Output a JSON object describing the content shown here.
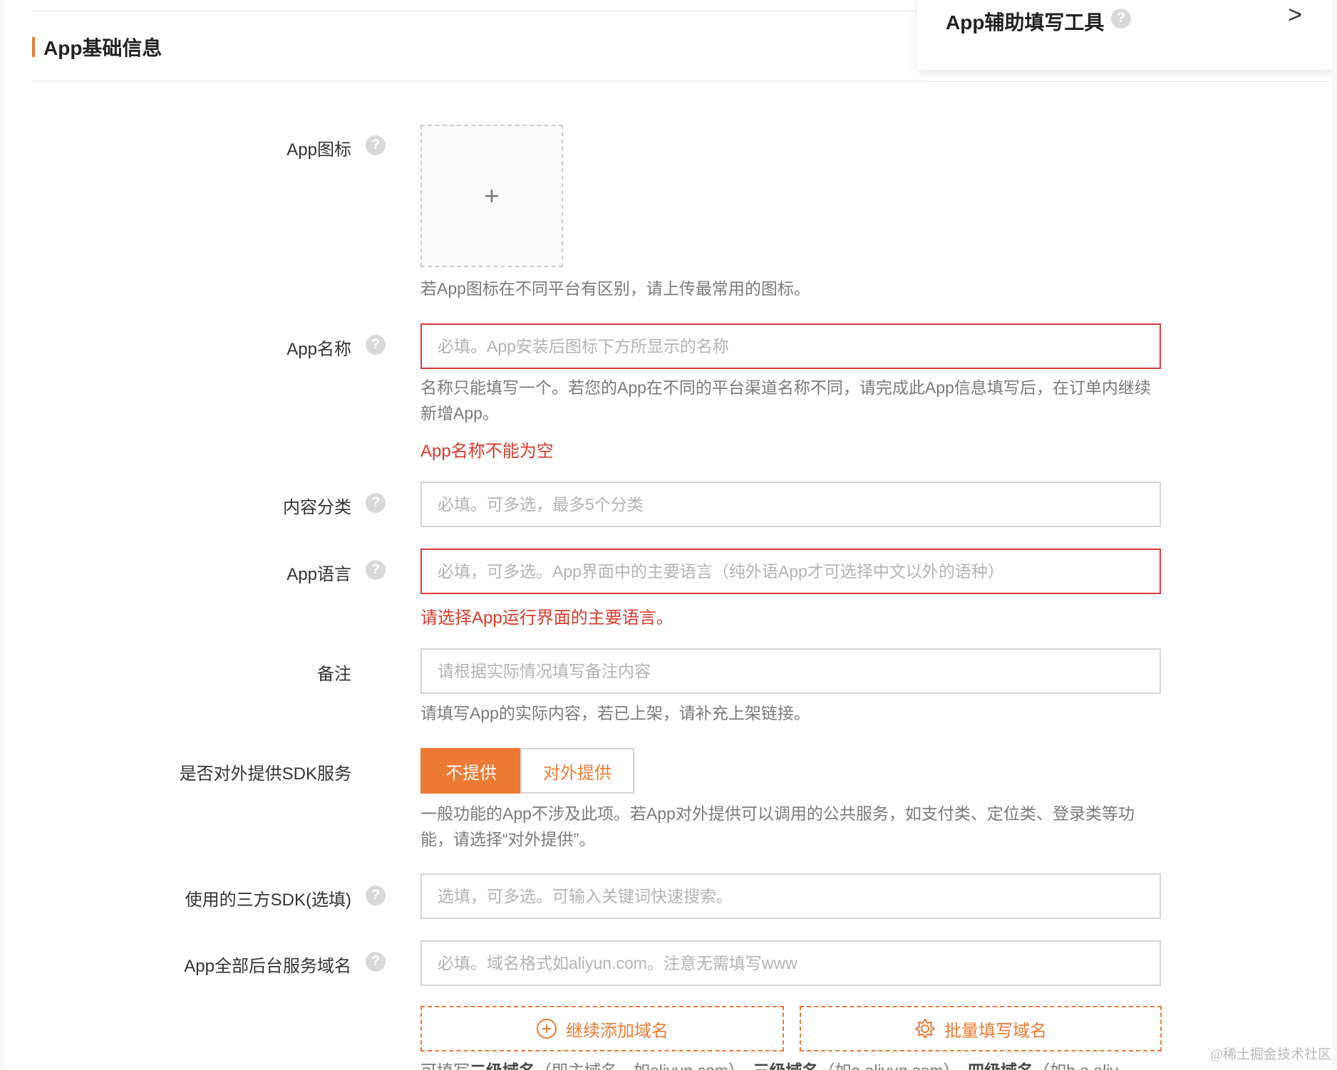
{
  "section": {
    "title": "App基础信息"
  },
  "helper_panel": {
    "title": "App辅助填写工具",
    "help_icon": "?",
    "chevron": ">"
  },
  "form": {
    "icon": {
      "label": "App图标",
      "upload_symbol": "+",
      "hint": "若App图标在不同平台有区别，请上传最常用的图标。"
    },
    "name": {
      "label": "App名称",
      "placeholder": "必填。App安装后图标下方所显示的名称",
      "hint": "名称只能填写一个。若您的App在不同的平台渠道名称不同，请完成此App信息填写后，在订单内继续新增App。",
      "error": "App名称不能为空"
    },
    "category": {
      "label": "内容分类",
      "placeholder": "必填。可多选，最多5个分类"
    },
    "language": {
      "label": "App语言",
      "placeholder": "必填，可多选。App界面中的主要语言（纯外语App才可选择中文以外的语种）",
      "error": "请选择App运行界面的主要语言。"
    },
    "remark": {
      "label": "备注",
      "placeholder": "请根据实际情况填写备注内容",
      "hint": "请填写App的实际内容，若已上架，请补充上架链接。"
    },
    "sdk_service": {
      "label": "是否对外提供SDK服务",
      "option_no": "不提供",
      "option_yes": "对外提供",
      "selected": "不提供",
      "hint": "一般功能的App不涉及此项。若App对外提供可以调用的公共服务，如支付类、定位类、登录类等功能，请选择“对外提供”。"
    },
    "third_party_sdk": {
      "label": "使用的三方SDK(选填)",
      "placeholder": "选填，可多选。可输入关键词快速搜索。"
    },
    "domains": {
      "label": "App全部后台服务域名",
      "placeholder": "必填。域名格式如aliyun.com。注意无需填写www",
      "add_button": "继续添加域名",
      "batch_button": "批量填写域名",
      "hint_prefix": "可填写",
      "hint_bold1": "二级域名",
      "hint_mid1": "（即主域名，如aliyun.com），",
      "hint_bold2": "三级域名",
      "hint_mid2": "（如a.aliyun.com），",
      "hint_bold3": "四级域名",
      "hint_mid3": "（如b.a.aliy"
    }
  },
  "colors": {
    "accent": "#ec7a34",
    "error": "#d93a2b"
  },
  "watermark": "@稀土掘金技术社区"
}
